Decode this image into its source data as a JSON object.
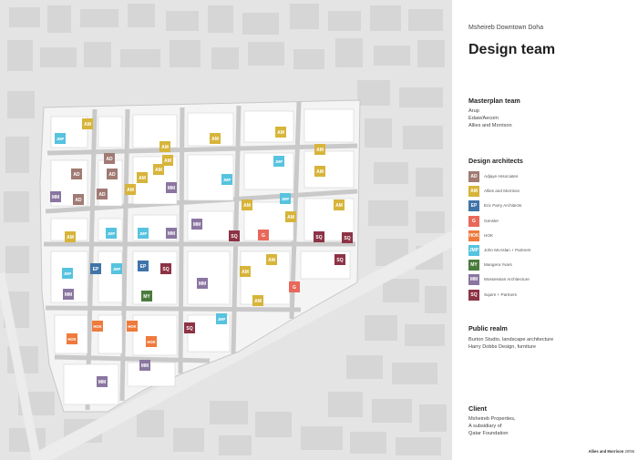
{
  "panel": {
    "kicker": "Msheireb Downtown Doha",
    "title": "Design team",
    "masterplan": {
      "title": "Masterplan team",
      "lines": [
        "Arup",
        "Edaw/Aecom",
        "Allies and Morrison"
      ]
    },
    "design_architects_title": "Design architects",
    "legend": [
      {
        "code": "AD",
        "name": "Adjaye Associates",
        "color": "#a07a73"
      },
      {
        "code": "AM",
        "name": "Allies and Morrison",
        "color": "#d7b43a"
      },
      {
        "code": "EP",
        "name": "Eric Parry Architects",
        "color": "#3f74a8"
      },
      {
        "code": "G",
        "name": "Gensler",
        "color": "#e8685b"
      },
      {
        "code": "HOK",
        "name": "HOK",
        "color": "#ee7a3c"
      },
      {
        "code": "JMP",
        "name": "John McAslan + Partners",
        "color": "#56c3df"
      },
      {
        "code": "MY",
        "name": "Mangera Yvars",
        "color": "#4a7b3d"
      },
      {
        "code": "MM",
        "name": "Mossessian Architecture",
        "color": "#8a76a0"
      },
      {
        "code": "SQ",
        "name": "Squire + Partners",
        "color": "#8d3346"
      }
    ],
    "public_realm": {
      "title": "Public realm",
      "lines": [
        "Burton Studio, landscape architecture",
        "Harry Dobbs Design, furniture"
      ]
    },
    "client": {
      "title": "Client",
      "lines": [
        "Msheireb Properties,",
        "A subsidiary of",
        "Qatar Foundation"
      ]
    },
    "footer": {
      "brand": "Allies and Morrison",
      "page": "20/56"
    }
  },
  "map": {
    "markers": [
      {
        "code": "AM",
        "at": [
          96,
          136
        ]
      },
      {
        "code": "JMP",
        "at": [
          66,
          152
        ]
      },
      {
        "code": "AM",
        "at": [
          308,
          145
        ]
      },
      {
        "code": "AM",
        "at": [
          236,
          152
        ]
      },
      {
        "code": "AM",
        "at": [
          181,
          161
        ]
      },
      {
        "code": "AD",
        "at": [
          120,
          174
        ]
      },
      {
        "code": "AM",
        "at": [
          184,
          176
        ]
      },
      {
        "code": "JMP",
        "at": [
          306,
          177
        ]
      },
      {
        "code": "AM",
        "at": [
          351,
          164
        ]
      },
      {
        "code": "AD",
        "at": [
          84,
          191
        ]
      },
      {
        "code": "AD",
        "at": [
          123,
          191
        ]
      },
      {
        "code": "AM",
        "at": [
          174,
          186
        ]
      },
      {
        "code": "AM",
        "at": [
          156,
          195
        ]
      },
      {
        "code": "JMP",
        "at": [
          249,
          197
        ]
      },
      {
        "code": "AM",
        "at": [
          351,
          188
        ]
      },
      {
        "code": "AD",
        "at": [
          112,
          213
        ]
      },
      {
        "code": "AM",
        "at": [
          143,
          208
        ]
      },
      {
        "code": "MM",
        "at": [
          188,
          206
        ]
      },
      {
        "code": "MM",
        "at": [
          61,
          216
        ]
      },
      {
        "code": "AD",
        "at": [
          86,
          219
        ]
      },
      {
        "code": "JMP",
        "at": [
          313,
          218
        ]
      },
      {
        "code": "AM",
        "at": [
          271,
          225
        ]
      },
      {
        "code": "AM",
        "at": [
          372,
          225
        ]
      },
      {
        "code": "AM",
        "at": [
          319,
          238
        ]
      },
      {
        "code": "MM",
        "at": [
          216,
          246
        ]
      },
      {
        "code": "JMP",
        "at": [
          122,
          256
        ]
      },
      {
        "code": "JMP",
        "at": [
          157,
          256
        ]
      },
      {
        "code": "MM",
        "at": [
          188,
          256
        ]
      },
      {
        "code": "SQ",
        "at": [
          257,
          259
        ]
      },
      {
        "code": "G",
        "at": [
          289,
          258
        ]
      },
      {
        "code": "SQ",
        "at": [
          350,
          260
        ]
      },
      {
        "code": "SQ",
        "at": [
          381,
          261
        ]
      },
      {
        "code": "AM",
        "at": [
          77,
          260
        ]
      },
      {
        "code": "AM",
        "at": [
          298,
          285
        ]
      },
      {
        "code": "SQ",
        "at": [
          373,
          285
        ]
      },
      {
        "code": "AM",
        "at": [
          269,
          298
        ]
      },
      {
        "code": "JMP",
        "at": [
          74,
          300
        ]
      },
      {
        "code": "EP",
        "at": [
          105,
          295
        ]
      },
      {
        "code": "JMP",
        "at": [
          128,
          295
        ]
      },
      {
        "code": "EP",
        "at": [
          157,
          292
        ]
      },
      {
        "code": "SQ",
        "at": [
          182,
          295
        ]
      },
      {
        "code": "MM",
        "at": [
          222,
          311
        ]
      },
      {
        "code": "G",
        "at": [
          323,
          315
        ]
      },
      {
        "code": "MY",
        "at": [
          161,
          325
        ]
      },
      {
        "code": "AM",
        "at": [
          283,
          330
        ]
      },
      {
        "code": "MM",
        "at": [
          75,
          323
        ]
      },
      {
        "code": "JMP",
        "at": [
          243,
          350
        ]
      },
      {
        "code": "HOK",
        "at": [
          107,
          358
        ]
      },
      {
        "code": "HOK",
        "at": [
          145,
          358
        ]
      },
      {
        "code": "SQ",
        "at": [
          208,
          360
        ]
      },
      {
        "code": "HOK",
        "at": [
          79,
          372
        ]
      },
      {
        "code": "HOK",
        "at": [
          166,
          375
        ]
      },
      {
        "code": "MM",
        "at": [
          159,
          401
        ]
      },
      {
        "code": "MM",
        "at": [
          112,
          419
        ]
      }
    ]
  }
}
